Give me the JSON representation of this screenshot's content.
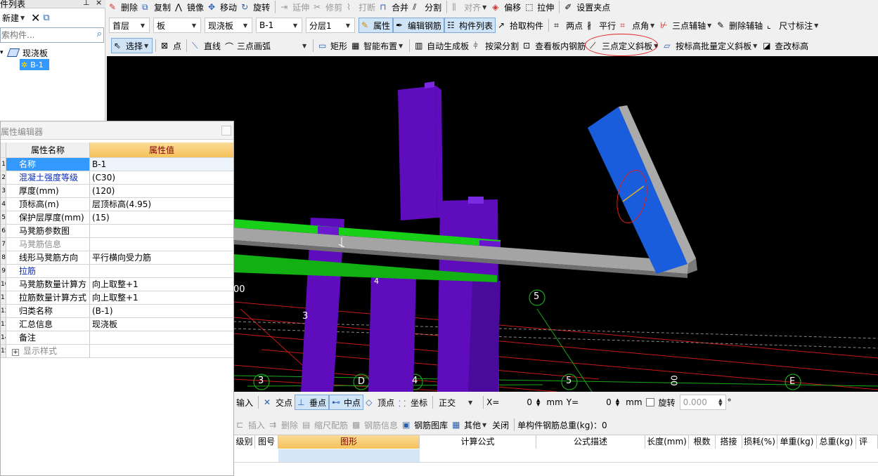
{
  "left_panel": {
    "title": "件列表",
    "pin_icon": "pin-icon",
    "new_label": "新建",
    "search_placeholder": "索构件...",
    "tree_root": "现浇板",
    "tree_child": "B-1"
  },
  "toolbar1": {
    "items": [
      "删除",
      "复制",
      "镜像",
      "移动",
      "旋转",
      "延伸",
      "修剪",
      "打断",
      "合并",
      "分割",
      "对齐",
      "偏移",
      "拉伸",
      "设置夹点"
    ]
  },
  "toolbar2": {
    "floor": "首层",
    "category": "板",
    "type": "现浇板",
    "component": "B-1",
    "layer": "分层1",
    "items": [
      "属性",
      "编辑钢筋",
      "构件列表",
      "拾取构件",
      "两点",
      "平行",
      "点角",
      "三点辅轴",
      "删除辅轴",
      "尺寸标注"
    ]
  },
  "toolbar3": {
    "items": [
      "选择",
      "点",
      "直线",
      "三点画弧",
      "矩形",
      "智能布置",
      "自动生成板",
      "按梁分割",
      "查看板内钢筋",
      "三点定义斜板",
      "按标高批量定义斜板",
      "查改标高"
    ]
  },
  "prop_editor": {
    "title": "属性编辑器",
    "col_name": "属性名称",
    "col_value": "属性值",
    "rows": [
      {
        "num": "1",
        "name": "名称",
        "value": "B-1",
        "style": "blue"
      },
      {
        "num": "2",
        "name": "混凝土强度等级",
        "value": "(C30)",
        "style": "blue"
      },
      {
        "num": "3",
        "name": "厚度(mm)",
        "value": "(120)",
        "style": ""
      },
      {
        "num": "4",
        "name": "顶标高(m)",
        "value": "层顶标高(4.95)",
        "style": ""
      },
      {
        "num": "5",
        "name": "保护层厚度(mm)",
        "value": "(15)",
        "style": ""
      },
      {
        "num": "6",
        "name": "马凳筋参数图",
        "value": "",
        "style": ""
      },
      {
        "num": "7",
        "name": "马凳筋信息",
        "value": "",
        "style": "gray"
      },
      {
        "num": "8",
        "name": "线形马凳筋方向",
        "value": "平行横向受力筋",
        "style": ""
      },
      {
        "num": "9",
        "name": "拉筋",
        "value": "",
        "style": "blue"
      },
      {
        "num": "10",
        "name": "马凳筋数量计算方",
        "value": "向上取整+1",
        "style": ""
      },
      {
        "num": "11",
        "name": "拉筋数量计算方式",
        "value": "向上取整+1",
        "style": ""
      },
      {
        "num": "12",
        "name": "归类名称",
        "value": "(B-1)",
        "style": ""
      },
      {
        "num": "13",
        "name": "汇总信息",
        "value": "现浇板",
        "style": ""
      },
      {
        "num": "14",
        "name": "备注",
        "value": "",
        "style": ""
      },
      {
        "num": "15",
        "name": "显示样式",
        "value": "",
        "style": ""
      }
    ]
  },
  "viewport": {
    "axis_labels": [
      "3",
      "D",
      "4",
      "5",
      "E",
      "5",
      "00",
      "3",
      "00",
      "4"
    ],
    "bg_color": "#000000",
    "column_color": "#6a0dc4",
    "beam_color": "#14c814",
    "slab_color": "#1a5ddc"
  },
  "snap_bar": {
    "input_label": "输入",
    "intersection": "交点",
    "perpendicular": "垂点",
    "midpoint": "中点",
    "vertex": "顶点",
    "coordinate": "坐标",
    "ortho": "正交",
    "x_label": "X=",
    "x_value": "0",
    "unit1": "mm",
    "y_label": "Y=",
    "y_value": "0",
    "unit2": "mm",
    "rotate_label": "旋转",
    "rotate_value": "0.000",
    "degree": "°"
  },
  "rebar_bar": {
    "items": [
      "插入",
      "删除",
      "缩尺配筋",
      "钢筋信息",
      "钢筋图库",
      "其他",
      "关闭"
    ],
    "total_label": "单构件钢筋总重(kg)：0"
  },
  "rebar_table": {
    "columns": [
      "级别",
      "图号",
      "图形",
      "计算公式",
      "公式描述",
      "长度(mm)",
      "根数",
      "搭接",
      "损耗(%)",
      "单重(kg)",
      "总重(kg)",
      "评"
    ]
  }
}
